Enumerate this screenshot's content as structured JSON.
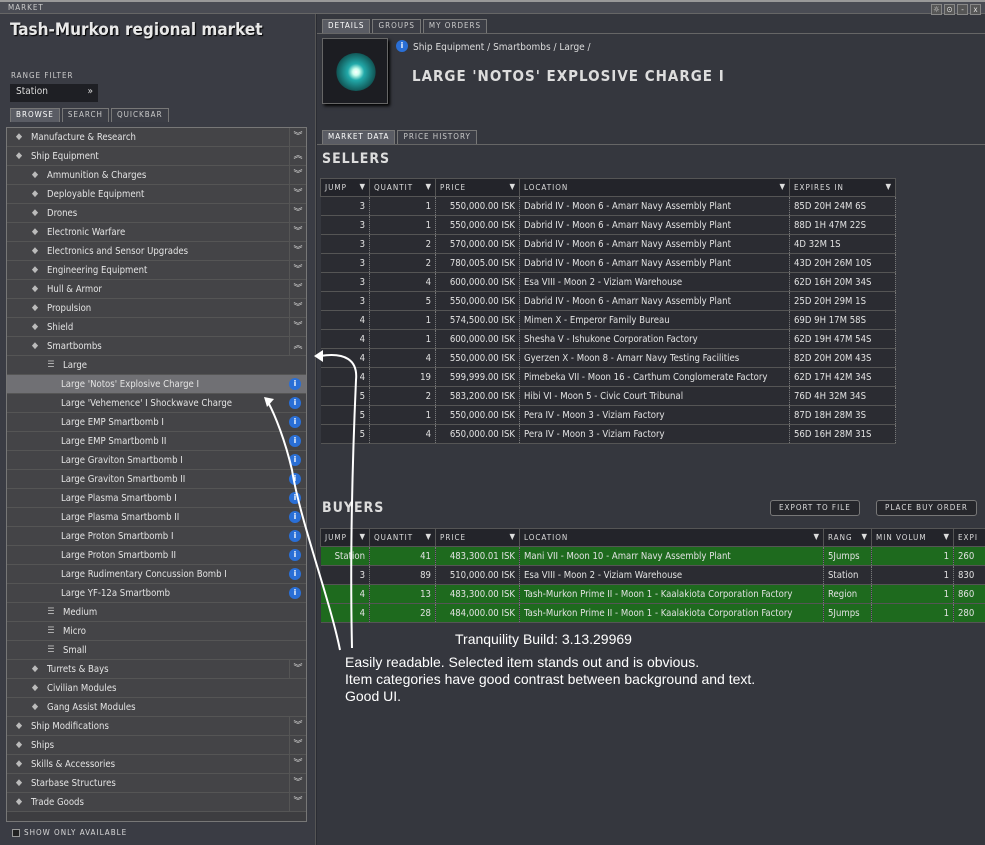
{
  "window": {
    "title": "MARKET",
    "buttons": [
      "☼",
      "⊙",
      "-",
      "x"
    ]
  },
  "left": {
    "title": "Tash-Murkon regional market",
    "range_label": "RANGE FILTER",
    "range_value": "Station",
    "tabs": [
      "BROWSE",
      "SEARCH",
      "QUICKBAR"
    ],
    "tree": [
      {
        "label": "Manufacture & Research",
        "level": 0,
        "icon": "gear-icon",
        "chev": "down"
      },
      {
        "label": "Ship Equipment",
        "level": 0,
        "icon": "module-icon",
        "chev": "up"
      },
      {
        "label": "Ammunition & Charges",
        "level": 1,
        "icon": "ammo-icon",
        "chev": "down"
      },
      {
        "label": "Deployable Equipment",
        "level": 1,
        "icon": "deployable-icon",
        "chev": "down"
      },
      {
        "label": "Drones",
        "level": 1,
        "icon": "drone-icon",
        "chev": "down"
      },
      {
        "label": "Electronic Warfare",
        "level": 1,
        "icon": "ewar-icon",
        "chev": "down"
      },
      {
        "label": "Electronics and Sensor Upgrades",
        "level": 1,
        "icon": "sensor-icon",
        "chev": "down"
      },
      {
        "label": "Engineering Equipment",
        "level": 1,
        "icon": "engineering-icon",
        "chev": "down"
      },
      {
        "label": "Hull & Armor",
        "level": 1,
        "icon": "armor-icon",
        "chev": "down"
      },
      {
        "label": "Propulsion",
        "level": 1,
        "icon": "propulsion-icon",
        "chev": "down"
      },
      {
        "label": "Shield",
        "level": 1,
        "icon": "shield-icon",
        "chev": "down"
      },
      {
        "label": "Smartbombs",
        "level": 1,
        "icon": "smartbomb-icon",
        "chev": "up"
      },
      {
        "label": "Large",
        "level": 2,
        "icon": "list-icon",
        "chev": ""
      },
      {
        "label": "Large 'Notos' Explosive Charge I",
        "level": 3,
        "info": true,
        "selected": true
      },
      {
        "label": "Large 'Vehemence' I Shockwave Charge",
        "level": 3,
        "info": true
      },
      {
        "label": "Large EMP Smartbomb I",
        "level": 3,
        "info": true
      },
      {
        "label": "Large EMP Smartbomb II",
        "level": 3,
        "info": true
      },
      {
        "label": "Large Graviton Smartbomb I",
        "level": 3,
        "info": true
      },
      {
        "label": "Large Graviton Smartbomb II",
        "level": 3,
        "info": true
      },
      {
        "label": "Large Plasma Smartbomb I",
        "level": 3,
        "info": true
      },
      {
        "label": "Large Plasma Smartbomb II",
        "level": 3,
        "info": true
      },
      {
        "label": "Large Proton Smartbomb I",
        "level": 3,
        "info": true
      },
      {
        "label": "Large Proton Smartbomb II",
        "level": 3,
        "info": true
      },
      {
        "label": "Large Rudimentary Concussion Bomb I",
        "level": 3,
        "info": true
      },
      {
        "label": "Large YF-12a Smartbomb",
        "level": 3,
        "info": true
      },
      {
        "label": "Medium",
        "level": 2,
        "icon": "list-icon",
        "chev": ""
      },
      {
        "label": "Micro",
        "level": 2,
        "icon": "list-icon",
        "chev": ""
      },
      {
        "label": "Small",
        "level": 2,
        "icon": "list-icon",
        "chev": ""
      },
      {
        "label": "Turrets & Bays",
        "level": 1,
        "icon": "turret-icon",
        "chev": "down"
      },
      {
        "label": "Civilian Modules",
        "level": 1,
        "icon": "civilian-icon",
        "chev": ""
      },
      {
        "label": "Gang Assist Modules",
        "level": 1,
        "icon": "gang-icon",
        "chev": ""
      },
      {
        "label": "Ship Modifications",
        "level": 0,
        "icon": "rig-icon",
        "chev": "down"
      },
      {
        "label": "Ships",
        "level": 0,
        "icon": "ship-icon",
        "chev": "down"
      },
      {
        "label": "Skills & Accessories",
        "level": 0,
        "icon": "skill-icon",
        "chev": "down"
      },
      {
        "label": "Starbase Structures",
        "level": 0,
        "icon": "starbase-icon",
        "chev": "down"
      },
      {
        "label": "Trade Goods",
        "level": 0,
        "icon": "goods-icon",
        "chev": "down"
      }
    ],
    "show_only_available": "SHOW ONLY AVAILABLE"
  },
  "right": {
    "tabs": [
      "DETAILS",
      "GROUPS",
      "MY ORDERS"
    ],
    "breadcrumb": "Ship Equipment / Smartbombs / Large /",
    "item_name": "LARGE 'NOTOS' EXPLOSIVE CHARGE I",
    "subtabs": [
      "MARKET DATA",
      "PRICE HISTORY"
    ],
    "sellers_title": "SELLERS",
    "sellers_columns": [
      "JUMP",
      "QUANTIT",
      "PRICE",
      "LOCATION",
      "EXPIRES IN"
    ],
    "sellers": [
      [
        "3",
        "1",
        "550,000.00 ISK",
        "Dabrid IV - Moon 6 - Amarr Navy Assembly Plant",
        "85D 20H 24M 6S"
      ],
      [
        "3",
        "1",
        "550,000.00 ISK",
        "Dabrid IV - Moon 6 - Amarr Navy Assembly Plant",
        "88D 1H 47M 22S"
      ],
      [
        "3",
        "2",
        "570,000.00 ISK",
        "Dabrid IV - Moon 6 - Amarr Navy Assembly Plant",
        "4D 32M 1S"
      ],
      [
        "3",
        "2",
        "780,005.00 ISK",
        "Dabrid IV - Moon 6 - Amarr Navy Assembly Plant",
        "43D 20H 26M 10S"
      ],
      [
        "3",
        "4",
        "600,000.00 ISK",
        "Esa VIII - Moon 2 - Viziam Warehouse",
        "62D 16H 20M 34S"
      ],
      [
        "3",
        "5",
        "550,000.00 ISK",
        "Dabrid IV - Moon 6 - Amarr Navy Assembly Plant",
        "25D 20H 29M 1S"
      ],
      [
        "4",
        "1",
        "574,500.00 ISK",
        "Mimen X - Emperor Family Bureau",
        "69D 9H 17M 58S"
      ],
      [
        "4",
        "1",
        "600,000.00 ISK",
        "Shesha V - Ishukone Corporation Factory",
        "62D 19H 47M 54S"
      ],
      [
        "4",
        "4",
        "550,000.00 ISK",
        "Gyerzen X - Moon 8 - Amarr Navy Testing Facilities",
        "82D 20H 20M 43S"
      ],
      [
        "4",
        "19",
        "599,999.00 ISK",
        "Pimebeka VII - Moon 16 - Carthum Conglomerate Factory",
        "62D 17H 42M 34S"
      ],
      [
        "5",
        "2",
        "583,200.00 ISK",
        "Hibi VI - Moon 5 - Civic Court Tribunal",
        "76D 4H 32M 34S"
      ],
      [
        "5",
        "1",
        "550,000.00 ISK",
        "Pera IV - Moon 3 - Viziam Factory",
        "87D 18H 28M 3S"
      ],
      [
        "5",
        "4",
        "650,000.00 ISK",
        "Pera IV - Moon 3 - Viziam Factory",
        "56D 16H 28M 31S"
      ]
    ],
    "buyers_title": "BUYERS",
    "export_button": "EXPORT TO FILE",
    "place_buy_button": "PLACE BUY ORDER",
    "buyers_columns": [
      "JUMP",
      "QUANTIT",
      "PRICE",
      "LOCATION",
      "RANG",
      "MIN VOLUM",
      "EXPI"
    ],
    "buyers": [
      {
        "cells": [
          "Station",
          "41",
          "483,300.01 ISK",
          "Mani VII - Moon 10 - Amarr Navy Assembly Plant",
          "5Jumps",
          "1",
          "260"
        ],
        "green": true
      },
      {
        "cells": [
          "3",
          "89",
          "510,000.00 ISK",
          "Esa VIII - Moon 2 - Viziam Warehouse",
          "Station",
          "1",
          "830"
        ],
        "green": false
      },
      {
        "cells": [
          "4",
          "13",
          "483,300.00 ISK",
          "Tash-Murkon Prime II - Moon 1 - Kaalakiota Corporation Factory",
          "Region",
          "1",
          "860"
        ],
        "green": true
      },
      {
        "cells": [
          "4",
          "28",
          "484,000.00 ISK",
          "Tash-Murkon Prime II - Moon 1 - Kaalakiota Corporation Factory",
          "5Jumps",
          "1",
          "280"
        ],
        "green": true
      }
    ]
  },
  "annotation": {
    "build": "Tranquility Build: 3.13.29969",
    "lines": [
      "Easily readable. Selected item stands out and is obvious.",
      "Item categories have good contrast between background and text.",
      "Good UI."
    ]
  },
  "colors": {
    "highlight_green": "#1e6a1e",
    "selected_row": "#707074",
    "info_blue": "#2a6fd6"
  }
}
